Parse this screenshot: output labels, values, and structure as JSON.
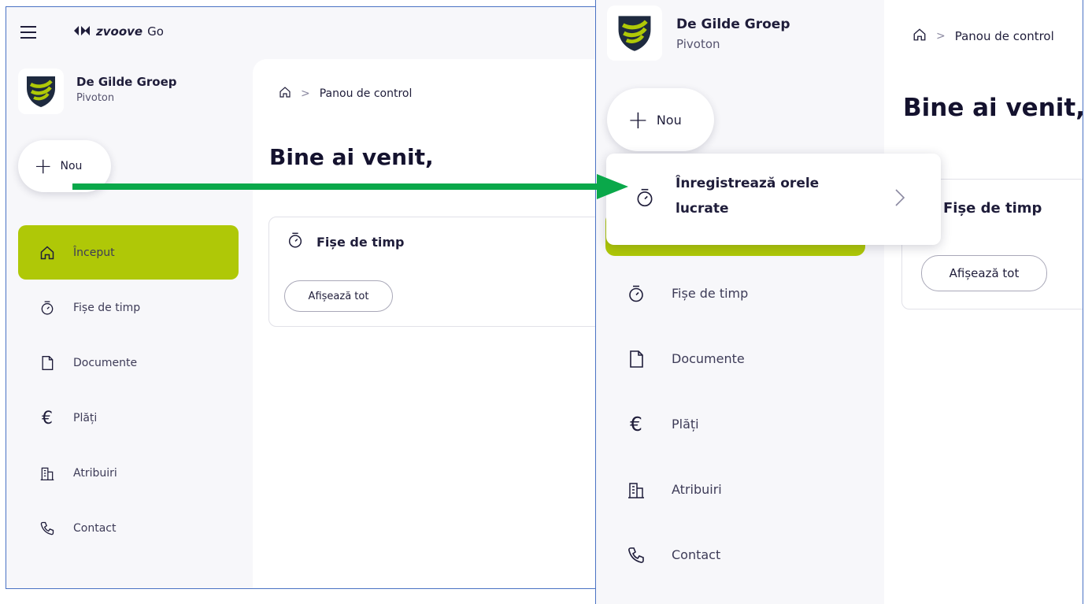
{
  "app": {
    "brand_name": "zvoove",
    "brand_suffix": "Go"
  },
  "org": {
    "name": "De Gilde Groep",
    "sub": "Pivoton"
  },
  "new_button": {
    "label": "Nou"
  },
  "nav": {
    "items": [
      {
        "label": "Început",
        "icon": "home-icon",
        "active": true
      },
      {
        "label": "Fișe de timp",
        "icon": "stopwatch-icon"
      },
      {
        "label": "Documente",
        "icon": "document-icon"
      },
      {
        "label": "Plăți",
        "icon": "euro-icon"
      },
      {
        "label": "Atribuiri",
        "icon": "building-icon"
      },
      {
        "label": "Contact",
        "icon": "phone-icon"
      }
    ]
  },
  "breadcrumb": {
    "current": "Panou de control"
  },
  "main": {
    "welcome": "Bine ai venit,",
    "card_title": "Fișe de timp",
    "show_all": "Afișează tot"
  },
  "dropdown": {
    "label": "Înregistrează orele lucrate"
  },
  "colors": {
    "accent": "#afc807",
    "arrow": "#0aa84a",
    "frame": "#4a72c4",
    "text": "#1f1d3a"
  }
}
